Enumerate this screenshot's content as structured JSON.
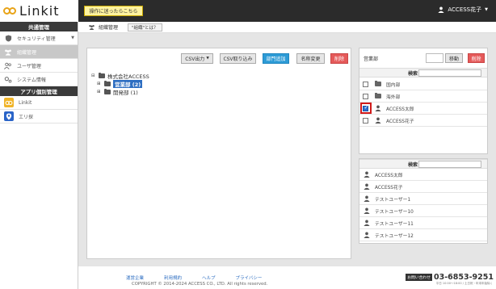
{
  "app": {
    "logo_text": "Linkit",
    "help_button": "操作に迷ったらこちら",
    "user_name": "ACCESS花子"
  },
  "sidebar": {
    "section_common": "共通管理",
    "common_items": [
      {
        "label": "セキュリティ管理"
      },
      {
        "label": "組織管理"
      },
      {
        "label": "ユーザ管理"
      },
      {
        "label": "システム情報"
      }
    ],
    "section_apps": "アプリ個別管理",
    "app_items": [
      {
        "label": "Linkit"
      },
      {
        "label": "エリ探"
      }
    ]
  },
  "tabs": {
    "active": "組織管理",
    "help": "\"組織\"とは？"
  },
  "toolbar": {
    "csv_output": "CSV出力",
    "csv_import": "CSV取り込み",
    "add_department": "部門追加",
    "rename": "名称変更",
    "delete": "削除"
  },
  "tree": {
    "root": "株式会社ACCESS",
    "children": [
      {
        "label": "営業部 (2)",
        "selected": true
      },
      {
        "label": "開発部 (1)",
        "selected": false
      }
    ]
  },
  "members_panel": {
    "title": "営業部",
    "move_button": "移動",
    "delete_button": "削除",
    "search_label": "検索",
    "items": [
      {
        "type": "folder",
        "label": "国内部",
        "checked": false
      },
      {
        "type": "folder",
        "label": "海外部",
        "checked": false
      },
      {
        "type": "user",
        "label": "ACCESS太郎",
        "checked": true
      },
      {
        "type": "user",
        "label": "ACCESS花子",
        "checked": false
      }
    ]
  },
  "users_panel": {
    "search_label": "検索",
    "items": [
      {
        "label": "ACCESS太郎"
      },
      {
        "label": "ACCESS花子"
      },
      {
        "label": "テストユーザー1"
      },
      {
        "label": "テストユーザー10"
      },
      {
        "label": "テストユーザー11"
      },
      {
        "label": "テストユーザー12"
      }
    ]
  },
  "footer": {
    "links": [
      "運営企業",
      "利用規約",
      "ヘルプ",
      "プライバシー"
    ],
    "copyright": "COPYRIGHT © 2014-2024 ACCESS CO., LTD. All rights reserved.",
    "contact_badge": "お問い合わせ",
    "contact_number": "03-6853-9251",
    "contact_hours": "平日 10:00〜18:00 / 土日祝・年末年始除く"
  },
  "colors": {
    "primary_blue": "#2d9bd6",
    "danger_red": "#e55a5a",
    "accent_yellow": "#e8a317",
    "dark_bar": "#2b2b2b"
  }
}
